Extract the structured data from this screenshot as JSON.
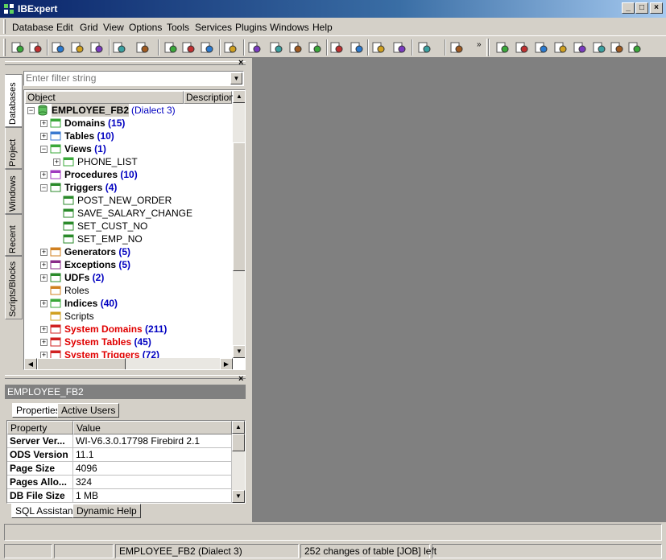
{
  "window": {
    "title": "IBExpert",
    "min_label": "_",
    "max_label": "□",
    "close_label": "×"
  },
  "menu": [
    "Database",
    "Edit",
    "Grid",
    "View",
    "Options",
    "Tools",
    "Services",
    "Plugins",
    "Windows",
    "Help"
  ],
  "toolbar_icons": [
    "register-db-icon",
    "unregister-db-icon",
    "connect-db-icon",
    "disconnect-db-icon",
    "reconnect-icon",
    "backup-icon",
    "exit-icon",
    "new-sql-editor-icon",
    "new-script-icon",
    "sql-monitor-icon",
    "grant-manager-icon",
    "database-statistics-icon",
    "extract-metadata-icon",
    "execute-icon",
    "print-icon",
    "users-icon",
    "keys-icon",
    "hash-icon",
    "next-icon",
    "open-file-icon",
    "save-icon",
    "new-domain-icon",
    "new-table-icon",
    "new-view-icon",
    "new-procedure-icon",
    "new-trigger-icon",
    "new-generator-icon",
    "new-exception-icon",
    "new-udf-icon"
  ],
  "colors": {
    "title_start": "#0a246a",
    "title_end": "#a6caf0",
    "mdi_bg": "#808080",
    "count_blue": "#0000c0",
    "system_red": "#e00000",
    "panel": "#d4d0c8"
  },
  "side_tabs": [
    "Databases",
    "Project",
    "Windows",
    "Recent",
    "Scripts/Blocks"
  ],
  "filter": {
    "placeholder": "Enter filter string"
  },
  "tree": {
    "headers": [
      "Object",
      "Description"
    ],
    "root": {
      "name": "EMPLOYEE_FB2",
      "suffix": "(Dialect 3)"
    },
    "nodes": [
      {
        "label": "Domains",
        "count": "(15)",
        "level": 1,
        "expander": "+",
        "icon": "domain-icon",
        "bold": true,
        "red": false
      },
      {
        "label": "Tables",
        "count": "(10)",
        "level": 1,
        "expander": "+",
        "icon": "table-icon",
        "bold": true,
        "red": false
      },
      {
        "label": "Views",
        "count": "(1)",
        "level": 1,
        "expander": "-",
        "icon": "view-icon",
        "bold": true,
        "red": false
      },
      {
        "label": "PHONE_LIST",
        "count": "",
        "level": 2,
        "expander": "+",
        "icon": "view-icon",
        "bold": false,
        "red": false
      },
      {
        "label": "Procedures",
        "count": "(10)",
        "level": 1,
        "expander": "+",
        "icon": "procedure-icon",
        "bold": true,
        "red": false
      },
      {
        "label": "Triggers",
        "count": "(4)",
        "level": 1,
        "expander": "-",
        "icon": "trigger-icon",
        "bold": true,
        "red": false
      },
      {
        "label": "POST_NEW_ORDER",
        "count": "",
        "level": 2,
        "expander": "",
        "icon": "trigger-icon",
        "bold": false,
        "red": false
      },
      {
        "label": "SAVE_SALARY_CHANGE",
        "count": "",
        "level": 2,
        "expander": "",
        "icon": "trigger-icon",
        "bold": false,
        "red": false
      },
      {
        "label": "SET_CUST_NO",
        "count": "",
        "level": 2,
        "expander": "",
        "icon": "trigger-icon",
        "bold": false,
        "red": false
      },
      {
        "label": "SET_EMP_NO",
        "count": "",
        "level": 2,
        "expander": "",
        "icon": "trigger-icon",
        "bold": false,
        "red": false
      },
      {
        "label": "Generators",
        "count": "(5)",
        "level": 1,
        "expander": "+",
        "icon": "generator-icon",
        "bold": true,
        "red": false
      },
      {
        "label": "Exceptions",
        "count": "(5)",
        "level": 1,
        "expander": "+",
        "icon": "exception-icon",
        "bold": true,
        "red": false
      },
      {
        "label": "UDFs",
        "count": "(2)",
        "level": 1,
        "expander": "+",
        "icon": "udf-icon",
        "bold": true,
        "red": false
      },
      {
        "label": "Roles",
        "count": "",
        "level": 1,
        "expander": "",
        "icon": "roles-icon",
        "bold": false,
        "red": false
      },
      {
        "label": "Indices",
        "count": "(40)",
        "level": 1,
        "expander": "+",
        "icon": "index-icon",
        "bold": true,
        "red": false
      },
      {
        "label": "Scripts",
        "count": "",
        "level": 1,
        "expander": "",
        "icon": "scripts-icon",
        "bold": false,
        "red": false
      },
      {
        "label": "System Domains",
        "count": "(211)",
        "level": 1,
        "expander": "+",
        "icon": "system-domain-icon",
        "bold": true,
        "red": true
      },
      {
        "label": "System Tables",
        "count": "(45)",
        "level": 1,
        "expander": "+",
        "icon": "system-table-icon",
        "bold": true,
        "red": true
      },
      {
        "label": "System Triggers",
        "count": "(72)",
        "level": 1,
        "expander": "+",
        "icon": "system-trigger-icon",
        "bold": true,
        "red": true
      }
    ]
  },
  "props_panel": {
    "db_name": "EMPLOYEE_FB2",
    "tabs": [
      "Properties",
      "Active Users"
    ],
    "headers": [
      "Property",
      "Value"
    ],
    "rows": [
      [
        "Server Ver...",
        "WI-V6.3.0.17798 Firebird 2.1"
      ],
      [
        "ODS Version",
        "11.1"
      ],
      [
        "Page Size",
        "4096"
      ],
      [
        "Pages Allo...",
        "324"
      ],
      [
        "DB File Size",
        "1 MB"
      ]
    ]
  },
  "bottom_tabs": [
    "SQL Assistant",
    "Dynamic Help"
  ],
  "status": {
    "db": "EMPLOYEE_FB2 (Dialect 3)",
    "changes": "252 changes of table [JOB] left"
  }
}
